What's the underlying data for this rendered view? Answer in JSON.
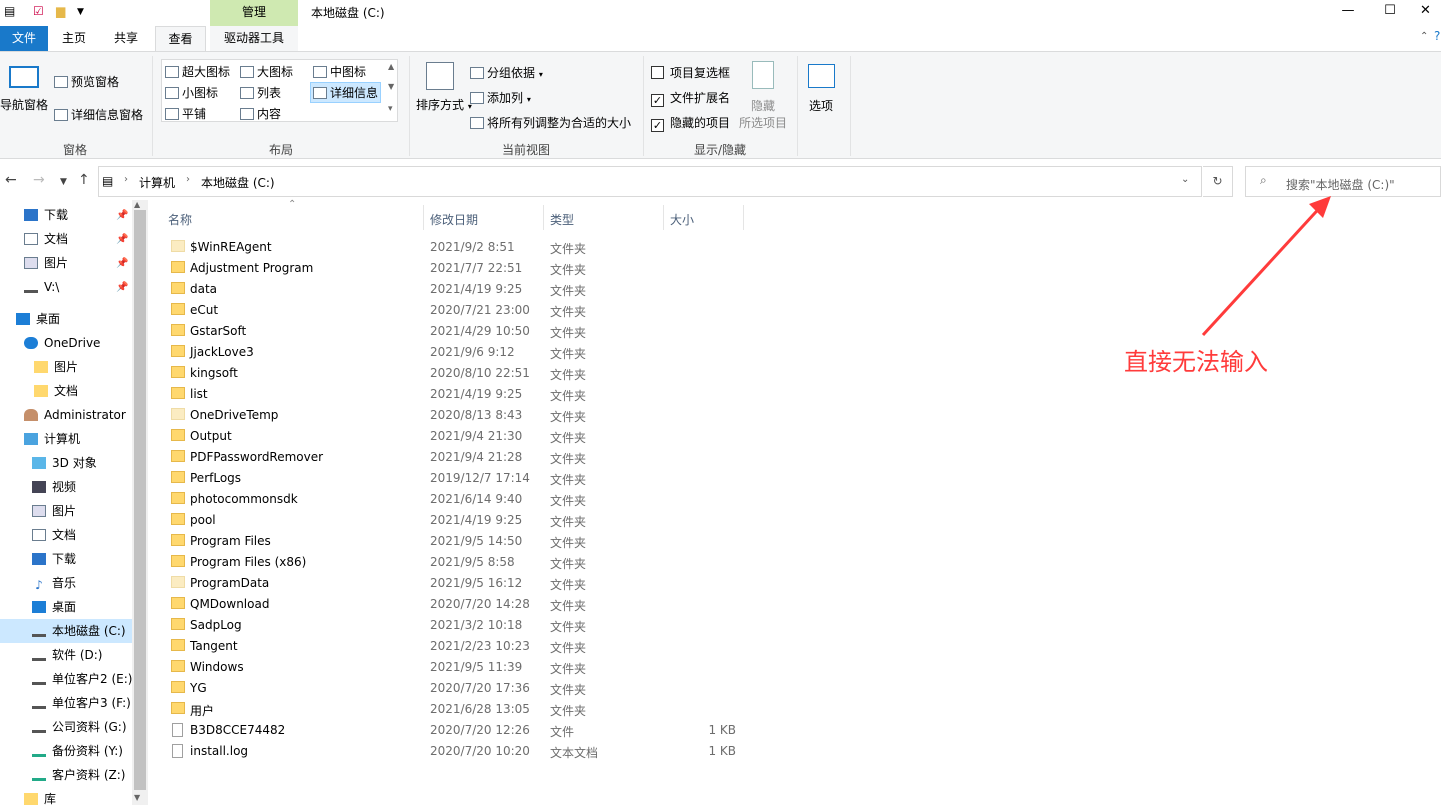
{
  "titlebar": {
    "title": "本地磁盘 (C:)",
    "context_tab": "管理",
    "minimize": "—",
    "maximize": "☐",
    "close": "✕"
  },
  "tabs": [
    "文件",
    "主页",
    "共享",
    "查看",
    "驱动器工具"
  ],
  "ribbon": {
    "panes": {
      "nav_pane": "导航窗格",
      "preview_pane": "预览窗格",
      "details_pane": "详细信息窗格",
      "label": "窗格"
    },
    "layout": {
      "items": [
        "超大图标",
        "大图标",
        "中图标",
        "小图标",
        "列表",
        "详细信息",
        "平铺",
        "内容"
      ],
      "label": "布局"
    },
    "current_view": {
      "sort": "排序方式",
      "group_by": "分组依据",
      "add_column": "添加列",
      "fit_columns": "将所有列调整为合适的大小",
      "label": "当前视图"
    },
    "show_hide": {
      "checkboxes": "项目复选框",
      "extensions": "文件扩展名",
      "hidden_items": "隐藏的项目",
      "hide_selected_1": "隐藏",
      "hide_selected_2": "所选项目",
      "label": "显示/隐藏",
      "checkboxes_checked": false,
      "extensions_checked": true,
      "hidden_checked": true
    },
    "options": "选项"
  },
  "address": {
    "crumbs": [
      "计算机",
      "本地磁盘 (C:)"
    ],
    "search_placeholder": "搜索\"本地磁盘 (C:)\""
  },
  "nav": {
    "quick": [
      {
        "label": "下载",
        "pinned": true
      },
      {
        "label": "文档",
        "pinned": true
      },
      {
        "label": "图片",
        "pinned": true
      },
      {
        "label": "V:\\",
        "pinned": true
      }
    ],
    "desktop": "桌面",
    "onedrive": "OneDrive",
    "onedrive_items": [
      "图片",
      "文档"
    ],
    "user": "Administrator",
    "computer": "计算机",
    "computer_items": [
      "3D 对象",
      "视频",
      "图片",
      "文档",
      "下载",
      "音乐",
      "桌面",
      "本地磁盘 (C:)",
      "软件 (D:)",
      "单位客户2 (E:)",
      "单位客户3 (F:)",
      "公司资料 (G:)",
      "备份资料 (Y:)",
      "客户资料 (Z:)"
    ],
    "library": "库",
    "selected": "本地磁盘 (C:)"
  },
  "columns": {
    "name": "名称",
    "date": "修改日期",
    "type": "类型",
    "size": "大小"
  },
  "files": [
    {
      "name": "$WinREAgent",
      "date": "2021/9/2 8:51",
      "type": "文件夹",
      "size": "",
      "kind": "folder-faint"
    },
    {
      "name": "Adjustment Program",
      "date": "2021/7/7 22:51",
      "type": "文件夹",
      "size": "",
      "kind": "folder"
    },
    {
      "name": "data",
      "date": "2021/4/19 9:25",
      "type": "文件夹",
      "size": "",
      "kind": "folder"
    },
    {
      "name": "eCut",
      "date": "2020/7/21 23:00",
      "type": "文件夹",
      "size": "",
      "kind": "folder"
    },
    {
      "name": "GstarSoft",
      "date": "2021/4/29 10:50",
      "type": "文件夹",
      "size": "",
      "kind": "folder"
    },
    {
      "name": "JjackLove3",
      "date": "2021/9/6 9:12",
      "type": "文件夹",
      "size": "",
      "kind": "folder"
    },
    {
      "name": "kingsoft",
      "date": "2020/8/10 22:51",
      "type": "文件夹",
      "size": "",
      "kind": "folder"
    },
    {
      "name": "list",
      "date": "2021/4/19 9:25",
      "type": "文件夹",
      "size": "",
      "kind": "folder"
    },
    {
      "name": "OneDriveTemp",
      "date": "2020/8/13 8:43",
      "type": "文件夹",
      "size": "",
      "kind": "folder-faint"
    },
    {
      "name": "Output",
      "date": "2021/9/4 21:30",
      "type": "文件夹",
      "size": "",
      "kind": "folder"
    },
    {
      "name": "PDFPasswordRemover",
      "date": "2021/9/4 21:28",
      "type": "文件夹",
      "size": "",
      "kind": "folder"
    },
    {
      "name": "PerfLogs",
      "date": "2019/12/7 17:14",
      "type": "文件夹",
      "size": "",
      "kind": "folder"
    },
    {
      "name": "photocommonsdk",
      "date": "2021/6/14 9:40",
      "type": "文件夹",
      "size": "",
      "kind": "folder"
    },
    {
      "name": "pool",
      "date": "2021/4/19 9:25",
      "type": "文件夹",
      "size": "",
      "kind": "folder"
    },
    {
      "name": "Program Files",
      "date": "2021/9/5 14:50",
      "type": "文件夹",
      "size": "",
      "kind": "folder"
    },
    {
      "name": "Program Files (x86)",
      "date": "2021/9/5 8:58",
      "type": "文件夹",
      "size": "",
      "kind": "folder"
    },
    {
      "name": "ProgramData",
      "date": "2021/9/5 16:12",
      "type": "文件夹",
      "size": "",
      "kind": "folder-faint"
    },
    {
      "name": "QMDownload",
      "date": "2020/7/20 14:28",
      "type": "文件夹",
      "size": "",
      "kind": "folder"
    },
    {
      "name": "SadpLog",
      "date": "2021/3/2 10:18",
      "type": "文件夹",
      "size": "",
      "kind": "folder"
    },
    {
      "name": "Tangent",
      "date": "2021/2/23 10:23",
      "type": "文件夹",
      "size": "",
      "kind": "folder"
    },
    {
      "name": "Windows",
      "date": "2021/9/5 11:39",
      "type": "文件夹",
      "size": "",
      "kind": "folder"
    },
    {
      "name": "YG",
      "date": "2020/7/20 17:36",
      "type": "文件夹",
      "size": "",
      "kind": "folder"
    },
    {
      "name": "用户",
      "date": "2021/6/28 13:05",
      "type": "文件夹",
      "size": "",
      "kind": "folder"
    },
    {
      "name": "B3D8CCE74482",
      "date": "2020/7/20 12:26",
      "type": "文件",
      "size": "1 KB",
      "kind": "file"
    },
    {
      "name": "install.log",
      "date": "2020/7/20 10:20",
      "type": "文本文档",
      "size": "1 KB",
      "kind": "file"
    }
  ],
  "annotation": {
    "text": "直接无法输入",
    "color": "#ff3b3b"
  }
}
